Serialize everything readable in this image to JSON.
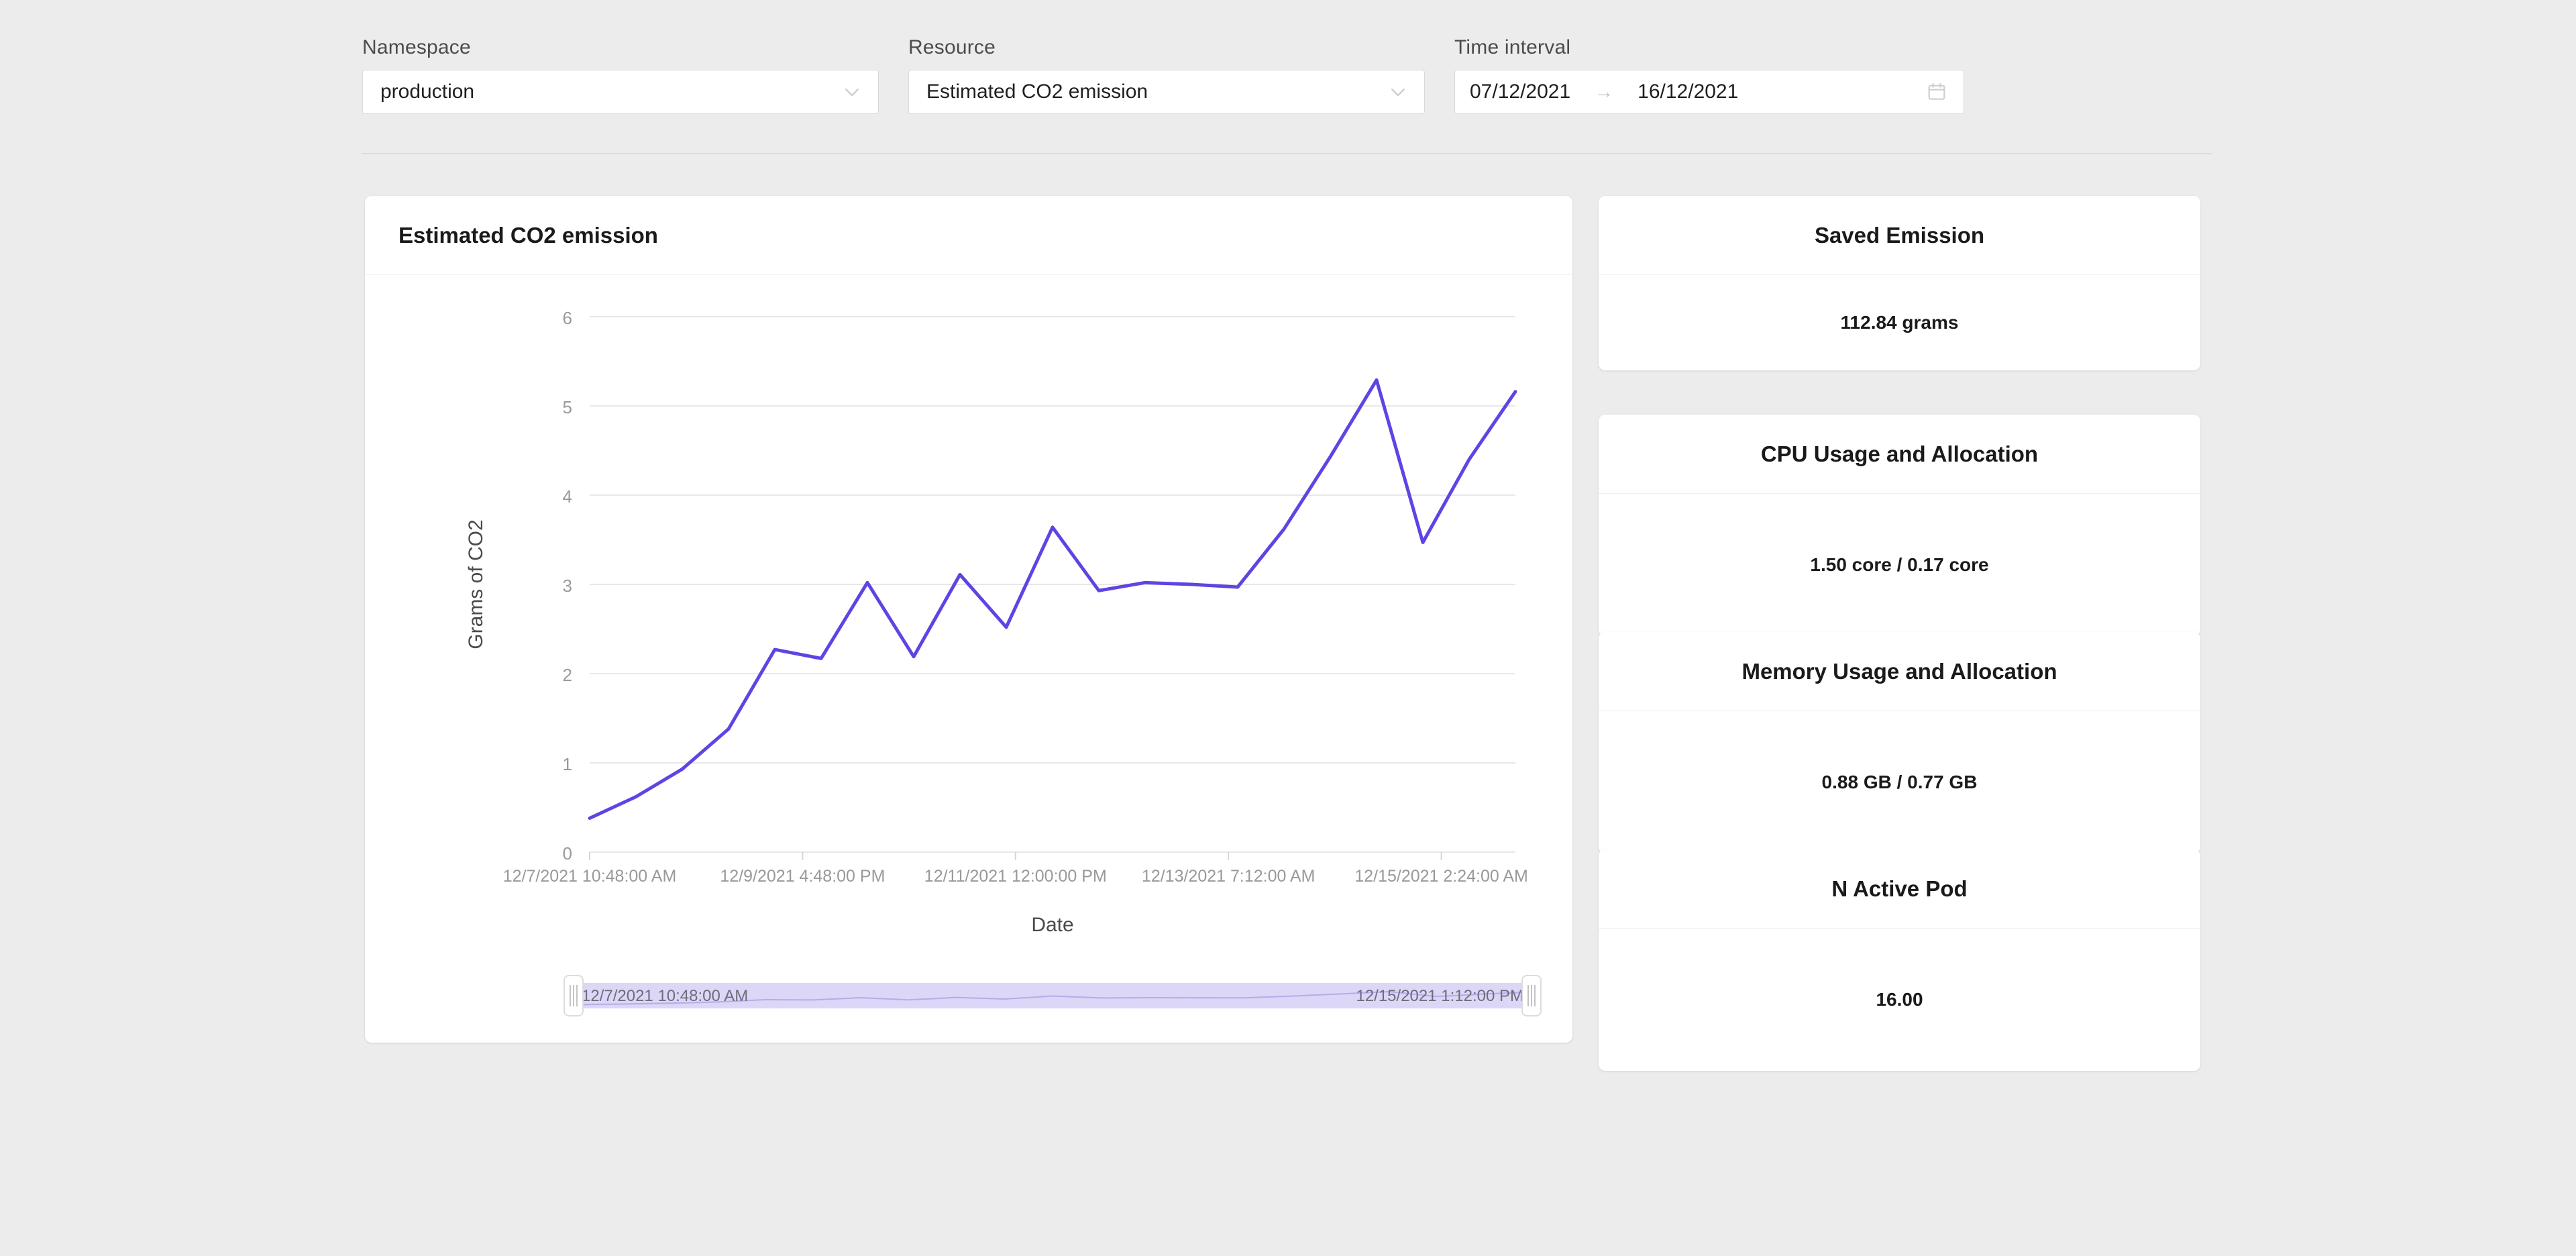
{
  "filters": {
    "namespace": {
      "label": "Namespace",
      "value": "production",
      "icon": "chevron-down-icon"
    },
    "resource": {
      "label": "Resource",
      "value": "Estimated CO2 emission",
      "icon": "chevron-down-icon"
    },
    "time_interval": {
      "label": "Time interval",
      "start": "07/12/2021",
      "separator": "→",
      "end": "16/12/2021",
      "icon": "calendar-icon"
    }
  },
  "chart_card": {
    "title": "Estimated CO2 emission",
    "range_slider": {
      "start_label": "12/7/2021 10:48:00 AM",
      "end_label": "12/15/2021 1:12:00 PM"
    }
  },
  "stats": [
    {
      "title": "Saved Emission",
      "value": "112.84 grams"
    },
    {
      "title": "CPU Usage and Allocation",
      "value": "1.50 core / 0.17 core"
    },
    {
      "title": "Memory Usage and Allocation",
      "value": "0.88 GB / 0.77 GB"
    },
    {
      "title": "N Active Pod",
      "value": "16.00"
    }
  ],
  "colors": {
    "line": "#5f44e4",
    "grid": "#e8e8e8",
    "axis_text": "#999999",
    "page_bg": "#ececec",
    "card_bg": "#ffffff",
    "slider_track": "#dcd6f7"
  },
  "chart_data": {
    "type": "line",
    "title": "Estimated CO2 emission",
    "xlabel": "Date",
    "ylabel": "Grams of CO2",
    "ylim": [
      0,
      6
    ],
    "ytick_values": [
      0,
      1,
      2,
      3,
      4,
      5,
      6
    ],
    "ytick_labels": [
      "0",
      "1",
      "2",
      "3",
      "4",
      "5",
      "6"
    ],
    "grid": true,
    "legend": "none",
    "xtick_labels": [
      "12/7/2021 10:48:00 AM",
      "12/9/2021 4:48:00 PM",
      "12/11/2021 12:00:00 PM",
      "12/13/2021 7:12:00 AM",
      "12/15/2021 2:24:00 AM"
    ],
    "xtick_positions": [
      0,
      4.6,
      9.2,
      13.8,
      18.4
    ],
    "x": [
      0,
      1,
      2,
      3,
      4,
      5,
      6,
      7,
      8,
      9,
      10,
      11,
      12,
      13,
      14,
      15,
      16,
      17,
      18,
      19,
      20
    ],
    "values": [
      0.38,
      0.62,
      0.93,
      1.38,
      2.27,
      2.17,
      3.02,
      2.19,
      3.11,
      2.52,
      3.64,
      2.93,
      3.02,
      3.0,
      2.97,
      3.62,
      4.43,
      5.29,
      3.47,
      4.4,
      5.16
    ],
    "series": [
      {
        "name": "Estimated CO2 emission",
        "values": [
          0.38,
          0.62,
          0.93,
          1.38,
          2.27,
          2.17,
          3.02,
          2.19,
          3.11,
          2.52,
          3.64,
          2.93,
          3.02,
          3.0,
          2.97,
          3.62,
          4.43,
          5.29,
          3.47,
          4.4,
          5.16
        ]
      }
    ]
  }
}
